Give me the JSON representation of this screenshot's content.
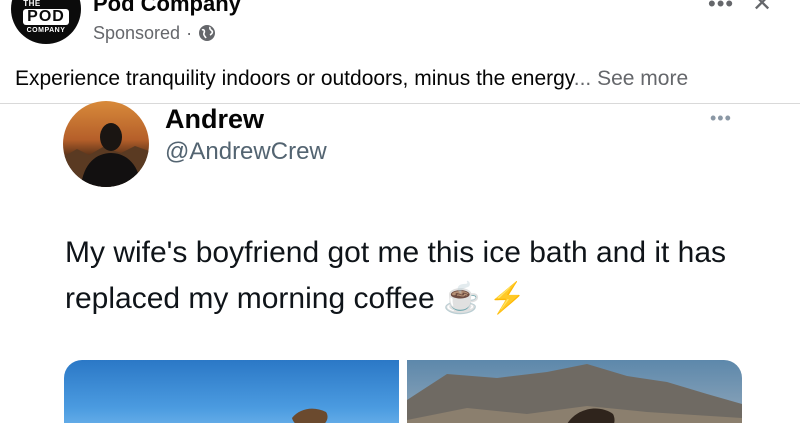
{
  "ad": {
    "logo_line1": "THE",
    "logo_line2": "POD",
    "logo_line3": "COMPANY",
    "advertiser": "Pod Company",
    "sponsored": "Sponsored",
    "dot": "·",
    "body_text": "Experience tranquility indoors or outdoors, minus the energy",
    "ellipsis": "...",
    "see_more": "See more"
  },
  "tweet": {
    "name": "Andrew",
    "handle": "@AndrewCrew",
    "text": "My wife's boyfriend got me this ice bath and it has replaced my morning coffee ☕ ⚡"
  },
  "icons": {
    "more": "more-options-icon",
    "close": "close-icon",
    "globe": "globe-icon"
  }
}
